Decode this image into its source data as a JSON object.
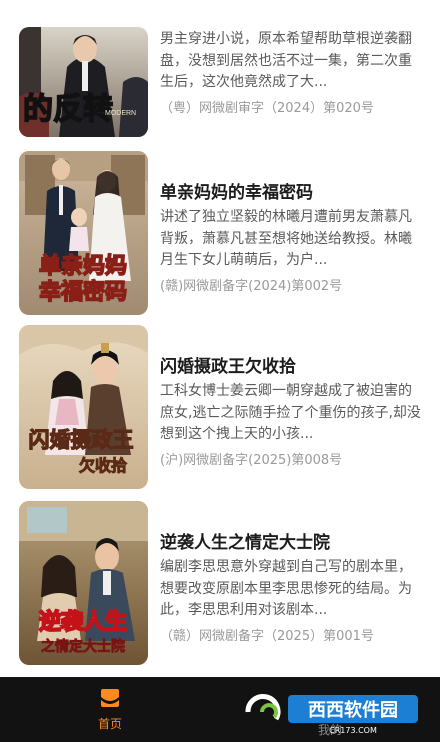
{
  "dramas": [
    {
      "title": "",
      "description": "男主穿进小说，原本希望帮助草根逆袭翻盘，没想到居然也活不过一集，第二次重生后，这次他竟然成了大...",
      "registration": "（粤）网微剧审字（2024）第020号",
      "poster_text": "的反转",
      "poster_small_text": "MODERN"
    },
    {
      "title": "单亲妈妈的幸福密码",
      "description": "讲述了独立坚毅的林曦月遭前男友萧慕凡背叛，萧慕凡甚至想将她送给教授。林曦月生下女儿萌萌后，为户...",
      "registration": "(赣)网微剧备字(2024)第002号",
      "poster_text_line1": "单亲妈妈",
      "poster_text_line2": "幸福密码"
    },
    {
      "title": "闪婚摄政王欠收拾",
      "description": "工科女博士姜云卿一朝穿越成了被迫害的庶女,逃亡之际随手捡了个重伤的孩子,却没想到这个拽上天的小孩...",
      "registration": "(沪)网微剧备字(2025)第008号",
      "poster_text_line1": "闪婚摄政王",
      "poster_text_line2": "欠收拾"
    },
    {
      "title": "逆袭人生之情定大士院",
      "description": "编剧李思思意外穿越到自己写的剧本里，想要改变原剧本里李思思惨死的结局。为此，李思思利用对该剧本...",
      "registration": "（赣）网微剧备字（2025）第001号",
      "poster_text_line1": "逆袭人生",
      "poster_text_line2": "之情定大士院"
    }
  ],
  "tabbar": {
    "home_label": "首页",
    "mine_label": "我的",
    "home_icon": "home-icon",
    "active_color": "#ff8a1e"
  },
  "watermark": {
    "logo_text": "西西软件园",
    "url_text": "CR173.COM"
  }
}
